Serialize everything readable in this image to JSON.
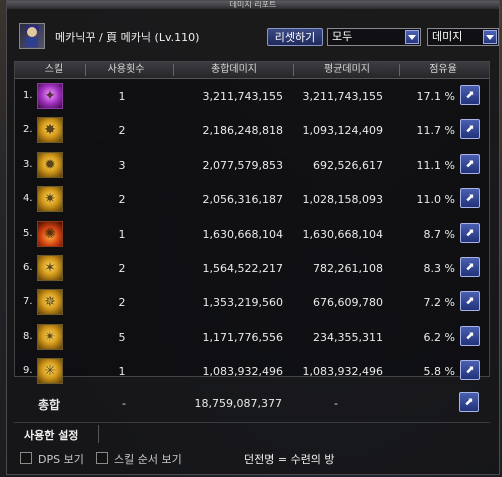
{
  "window": {
    "title": "데미지 리포트"
  },
  "header": {
    "character": "메카닉꾸 / 頁 메카닉 (Lv.110)",
    "reset_label": "리셋하기",
    "filter_value": "모두",
    "metric_value": "데미지"
  },
  "table": {
    "columns": [
      "스킬",
      "사용횟수",
      "총합데미지",
      "평균데미지",
      "점유율"
    ],
    "rows": [
      {
        "rank": "1.",
        "icon": "purple-skill-icon",
        "uses": "1",
        "total": "3,211,743,155",
        "avg": "3,211,743,155",
        "pct": "17.1 %"
      },
      {
        "rank": "2.",
        "icon": "gold-skill-icon",
        "uses": "2",
        "total": "2,186,248,818",
        "avg": "1,093,124,409",
        "pct": "11.7 %"
      },
      {
        "rank": "3.",
        "icon": "gold-skill-icon",
        "uses": "3",
        "total": "2,077,579,853",
        "avg": "692,526,617",
        "pct": "11.1 %"
      },
      {
        "rank": "4.",
        "icon": "gold-skill-icon",
        "uses": "2",
        "total": "2,056,316,187",
        "avg": "1,028,158,093",
        "pct": "11.0 %"
      },
      {
        "rank": "5.",
        "icon": "fire-skill-icon",
        "uses": "1",
        "total": "1,630,668,104",
        "avg": "1,630,668,104",
        "pct": "8.7 %"
      },
      {
        "rank": "6.",
        "icon": "gold-skill-icon",
        "uses": "2",
        "total": "1,564,522,217",
        "avg": "782,261,108",
        "pct": "8.3 %"
      },
      {
        "rank": "7.",
        "icon": "gold-skill-icon",
        "uses": "2",
        "total": "1,353,219,560",
        "avg": "676,609,780",
        "pct": "7.2 %"
      },
      {
        "rank": "8.",
        "icon": "gold-skill-icon",
        "uses": "5",
        "total": "1,171,776,556",
        "avg": "234,355,311",
        "pct": "6.2 %"
      },
      {
        "rank": "9.",
        "icon": "gold-skill-icon",
        "uses": "1",
        "total": "1,083,932,496",
        "avg": "1,083,932,496",
        "pct": "5.8 %"
      }
    ]
  },
  "total": {
    "label": "총합",
    "uses": "-",
    "total": "18,759,087,377",
    "avg": "-"
  },
  "used_set": {
    "label": "사용한 설정"
  },
  "footer": {
    "dps_label": "DPS 보기",
    "order_label": "스킬 순서 보기",
    "dungeon": "던전명 = 수련의 방"
  },
  "colors": {
    "accent_blue": "#3b4a86",
    "panel_bg": "#161618",
    "text": "#e6e6e6"
  }
}
